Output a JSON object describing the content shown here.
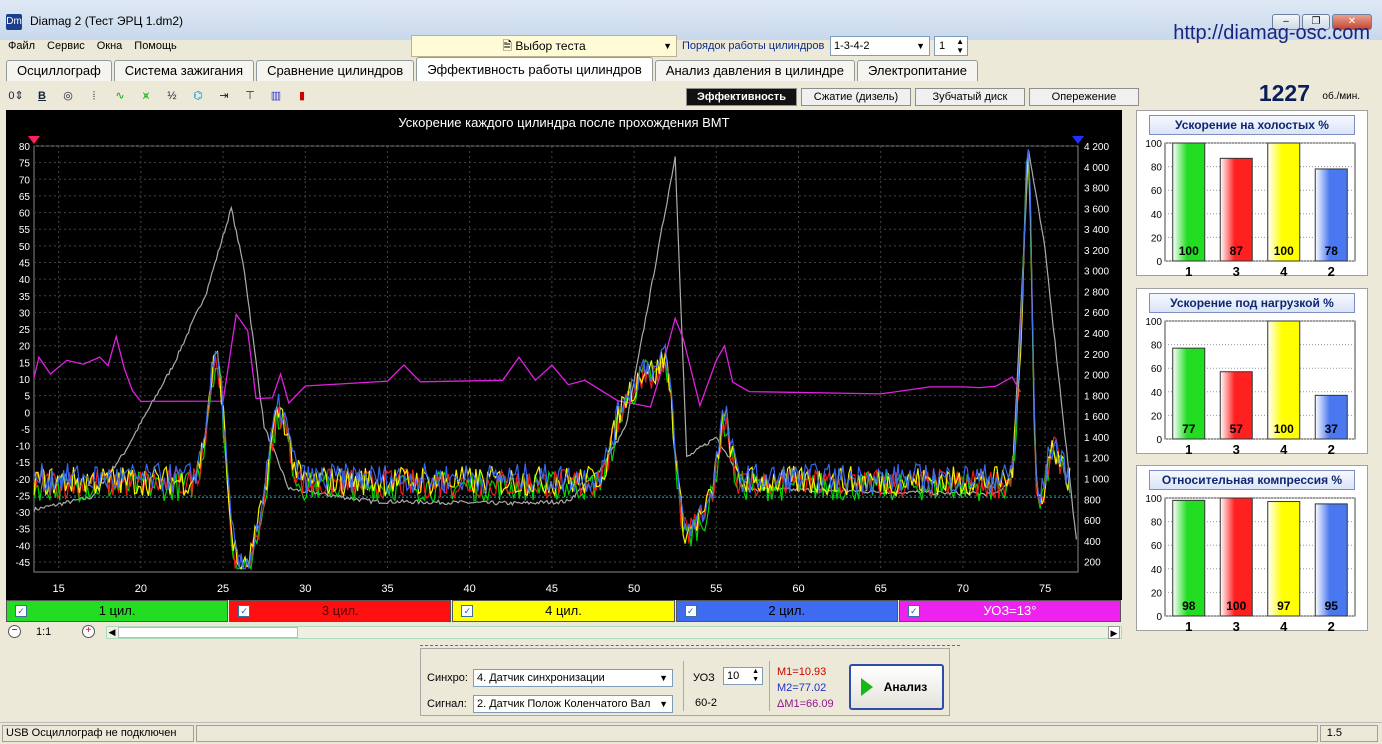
{
  "window": {
    "title": "Diamag 2 (Тест ЭРЦ 1.dm2)",
    "url": "http://diamag-osc.com",
    "icon": "Dm"
  },
  "menu": [
    "Файл",
    "Сервис",
    "Окна",
    "Помощь"
  ],
  "test_select": "Выбор теста",
  "cylinder_order": {
    "label": "Порядок работы цилиндров",
    "value": "1-3-4-2",
    "spin_value": "1"
  },
  "tabs": [
    "Осциллограф",
    "Система зажигания",
    "Сравнение цилиндров",
    "Эффективность работы цилиндров",
    "Анализ давления в цилиндре",
    "Электропитание"
  ],
  "active_tab": 3,
  "subtabs": [
    "Эффективность",
    "Сжатие (дизель)",
    "Зубчатый диск",
    "Опережение"
  ],
  "rpm": {
    "value": "1227",
    "unit": "об./мин."
  },
  "chart_data": {
    "type": "line",
    "title": "Ускорение каждого цилиндра после прохождения ВМТ",
    "x_ticks": [
      15,
      20,
      25,
      30,
      35,
      40,
      45,
      50,
      55,
      60,
      65,
      70,
      75
    ],
    "xlim": [
      13.5,
      77
    ],
    "y_left_ticks": [
      80,
      75,
      70,
      65,
      60,
      55,
      50,
      45,
      40,
      35,
      30,
      25,
      20,
      15,
      10,
      5,
      0,
      -5,
      -10,
      -15,
      -20,
      -25,
      -30,
      -35,
      -40,
      -45
    ],
    "ylim_left": [
      -48,
      80
    ],
    "y_right_ticks": [
      "4 200",
      "4 000",
      "3 800",
      "3 600",
      "3 400",
      "3 200",
      "3 000",
      "2 800",
      "2 600",
      "2 400",
      "2 200",
      "2 000",
      "1 800",
      "1 600",
      "1 400",
      "1 200",
      "1 000",
      "800",
      "600",
      "400",
      "200"
    ],
    "ylim_right": [
      100,
      4200
    ],
    "series": [
      {
        "name": "1 цил.",
        "color": "#00e000"
      },
      {
        "name": "3 цил.",
        "color": "#ff1a1a"
      },
      {
        "name": "4 цил.",
        "color": "#ffff00"
      },
      {
        "name": "2 цил.",
        "color": "#3a6cff"
      },
      {
        "name": "УОЗ=13°",
        "color": "#e020e0"
      }
    ],
    "rpm_trace_color": "#aaaaaa",
    "baseline_value": -25.5
  },
  "legend": [
    {
      "label": "1 цил.",
      "bg": "#22dd22",
      "fg": "#000000"
    },
    {
      "label": "3 цил.",
      "bg": "#ff1010",
      "fg": "#5a0000"
    },
    {
      "label": "4 цил.",
      "bg": "#ffff00",
      "fg": "#000000"
    },
    {
      "label": "2 цил.",
      "bg": "#3d6cf0",
      "fg": "#000000"
    },
    {
      "label": "УОЗ=13°",
      "bg": "#ee22ee",
      "fg": "#ffffff"
    }
  ],
  "zoom": "1:1",
  "panels": [
    {
      "title": "Ускорение на холостых %",
      "values": [
        100,
        87,
        100,
        78
      ],
      "labels": [
        "1",
        "3",
        "4",
        "2"
      ],
      "yticks": [
        "100",
        "80",
        "60",
        "40",
        "20",
        "0"
      ]
    },
    {
      "title": "Ускорение под нагрузкой %",
      "values": [
        77,
        57,
        100,
        37
      ],
      "labels": [
        "1",
        "3",
        "4",
        "2"
      ],
      "yticks": [
        "100",
        "80",
        "60",
        "40",
        "20",
        "0"
      ]
    },
    {
      "title": "Относительная компрессия %",
      "values": [
        98,
        100,
        97,
        95
      ],
      "labels": [
        "1",
        "3",
        "4",
        "2"
      ],
      "yticks": [
        "100",
        "80",
        "60",
        "40",
        "20",
        "0"
      ]
    }
  ],
  "bar_colors": [
    "#22dd22",
    "#ff2020",
    "#ffff00",
    "#4a78f0"
  ],
  "bottom": {
    "sync_label": "Синхро:",
    "sync_value": "4.  Датчик синхронизации",
    "signal_label": "Сигнал:",
    "signal_value": "2.  Датчик Полож Коленчатого Вал",
    "uoz_label": "УОЗ",
    "uoz_value": "10",
    "ratio": "60-2",
    "m1": "M1=10.93",
    "m2": "M2=77.02",
    "dm1": "ΔM1=66.09",
    "analyze": "Анализ"
  },
  "status": {
    "text": "USB Осциллограф не подключен",
    "version": "1.5"
  }
}
